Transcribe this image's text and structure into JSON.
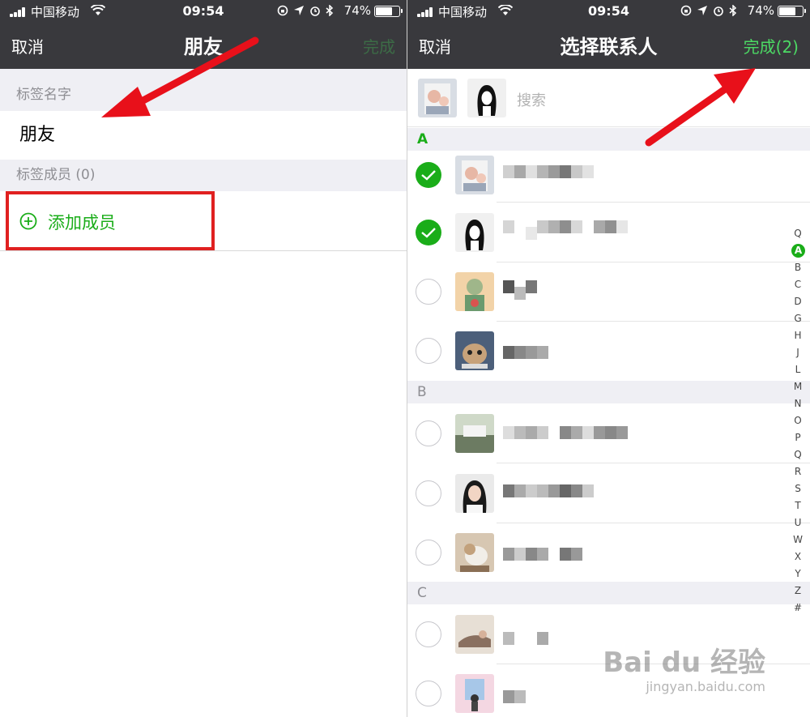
{
  "status_bar": {
    "carrier": "中国移动",
    "time": "09:54",
    "battery_text": "74%",
    "battery_level": 0.74
  },
  "left_screen": {
    "nav": {
      "cancel": "取消",
      "title": "朋友",
      "done": "完成"
    },
    "label_name_section": "标签名字",
    "label_name_value": "朋友",
    "members_section": "标签成员 (0)",
    "add_member": "添加成员",
    "colors": {
      "accent": "#1aad19",
      "highlight_box": "#e02020"
    }
  },
  "right_screen": {
    "nav": {
      "cancel": "取消",
      "title": "选择联系人",
      "done": "完成(2)"
    },
    "search_placeholder": "搜索",
    "groups": [
      {
        "letter": "A",
        "contacts": [
          {
            "checked": true
          },
          {
            "checked": true
          },
          {
            "checked": false
          },
          {
            "checked": false
          }
        ]
      },
      {
        "letter": "B",
        "contacts": [
          {
            "checked": false
          },
          {
            "checked": false
          },
          {
            "checked": false
          }
        ]
      },
      {
        "letter": "C",
        "contacts": [
          {
            "checked": false
          },
          {
            "checked": false
          }
        ]
      }
    ],
    "index_letters": [
      "Q",
      "A",
      "B",
      "C",
      "D",
      "G",
      "H",
      "J",
      "L",
      "M",
      "N",
      "O",
      "P",
      "Q",
      "R",
      "S",
      "T",
      "U",
      "W",
      "X",
      "Y",
      "Z",
      "#"
    ],
    "index_active": "A"
  },
  "watermark": {
    "brand": "Bai du 经验",
    "url": "jingyan.baidu.com"
  },
  "icons": {
    "back": "chevron-left-icon",
    "add": "plus-circle-icon",
    "check": "checkmark-icon",
    "arrow": "red-arrow-icon"
  }
}
